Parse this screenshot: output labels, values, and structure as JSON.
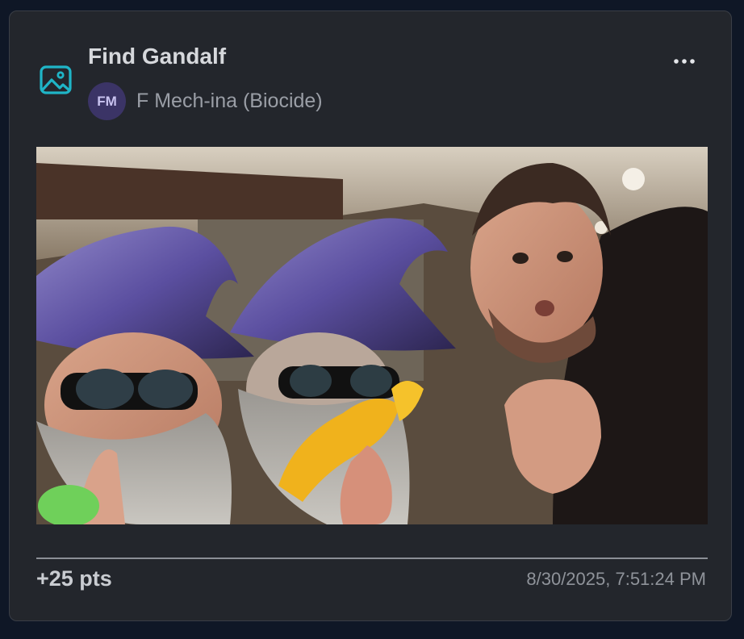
{
  "post": {
    "title": "Find Gandalf",
    "type_icon": "image-icon",
    "author": {
      "initials": "FM",
      "name": "F Mech-ina (Biocide)"
    },
    "menu_icon": "more-horizontal-icon",
    "photo_icon": "photo",
    "points": "+25 pts",
    "timestamp": "8/30/2025, 7:51:24 PM"
  },
  "colors": {
    "background": "#0f1726",
    "card": "#23262c",
    "accent_icon": "#1fb5c7",
    "avatar_bg": "#3b3466",
    "avatar_text": "#c9c3f0"
  }
}
